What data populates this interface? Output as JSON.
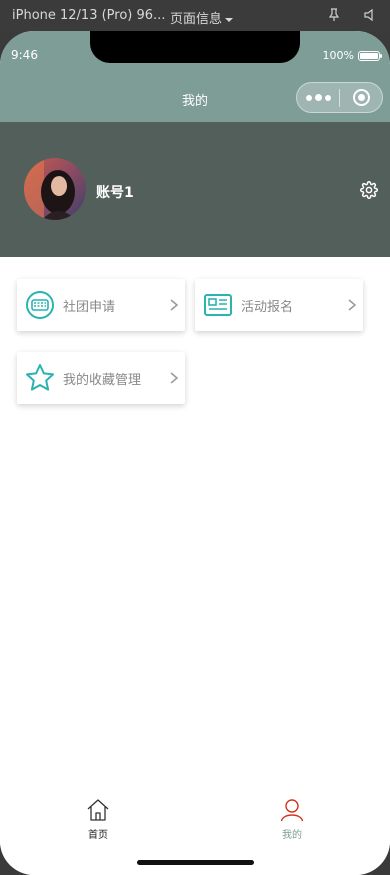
{
  "simulator": {
    "device": "iPhone 12/13 (Pro) 96...",
    "page_info": "页面信息"
  },
  "status_bar": {
    "time": "9:46",
    "battery": "100%"
  },
  "nav": {
    "title": "我的"
  },
  "profile": {
    "username": "账号1"
  },
  "menu": [
    {
      "label": "社团申请",
      "icon": "keyboard-icon"
    },
    {
      "label": "活动报名",
      "icon": "id-card-icon"
    },
    {
      "label": "我的收藏管理",
      "icon": "star-icon"
    }
  ],
  "tabbar": {
    "home_label": "首页",
    "mine_label": "我的"
  },
  "colors": {
    "header_bg": "#7e9d97",
    "profile_bg": "#535f5b",
    "accent": "#2bb3b0",
    "active_tab_icon": "#d2351e",
    "active_tab_label": "#7e9d97"
  }
}
